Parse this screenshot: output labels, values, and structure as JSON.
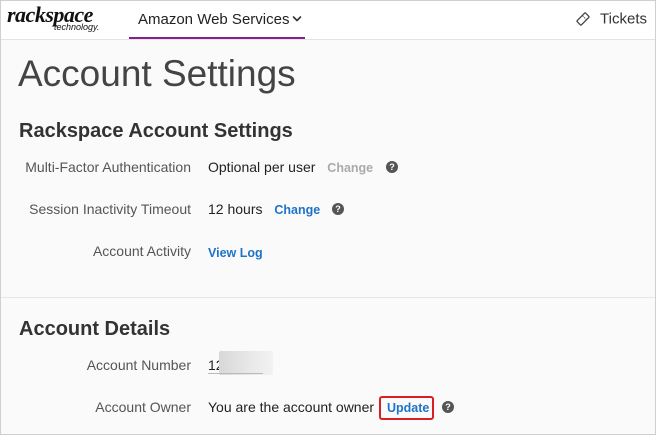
{
  "header": {
    "logo_main": "rackspace",
    "logo_sub": "technology.",
    "nav_tab_label": "Amazon Web Services",
    "tickets_label": "Tickets",
    "accent_color": "#8b1e8f"
  },
  "page": {
    "title": "Account Settings"
  },
  "rackspace_settings": {
    "title": "Rackspace Account Settings",
    "rows": [
      {
        "label": "Multi-Factor Authentication",
        "value": "Optional per user",
        "link": "Change",
        "link_state": "disabled",
        "help": "?"
      },
      {
        "label": "Session Inactivity Timeout",
        "value": "12 hours",
        "link": "Change",
        "link_state": "enabled",
        "help": "?"
      },
      {
        "label": "Account Activity",
        "link": "View Log",
        "link_state": "enabled"
      }
    ]
  },
  "account_details": {
    "title": "Account Details",
    "rows": [
      {
        "label": "Account Number",
        "value": "12"
      },
      {
        "label": "Account Owner",
        "value": "You are the account owner",
        "link": "Update",
        "help": "?"
      }
    ]
  },
  "colors": {
    "link": "#1f73c7",
    "highlight": "#d81f26"
  }
}
